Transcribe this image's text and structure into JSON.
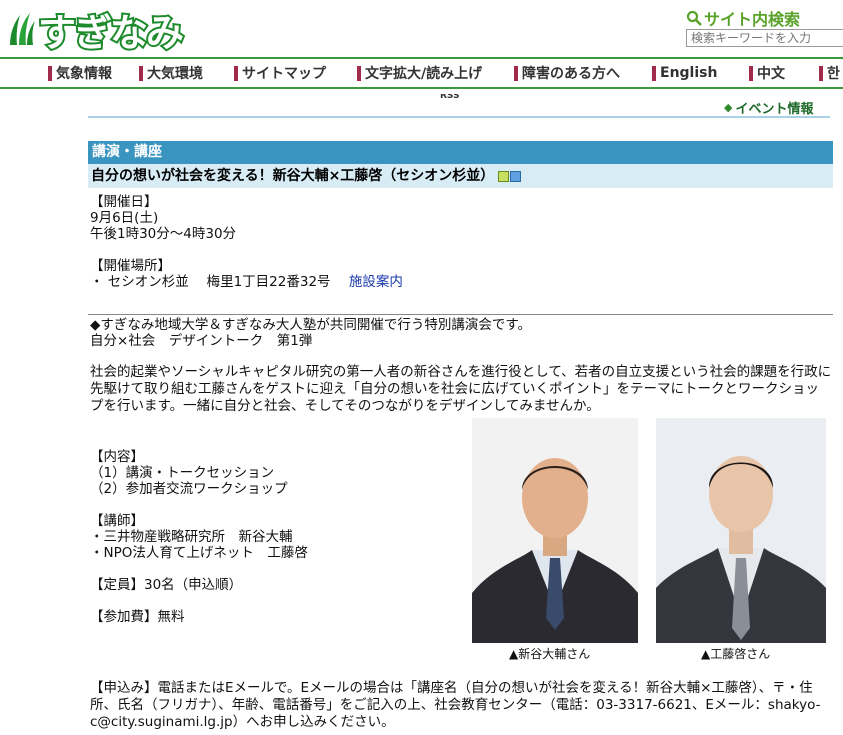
{
  "header": {
    "logo_text": "すぎなみ",
    "search_title": "サイト内検索",
    "search_placeholder": "検索キーワードを入力"
  },
  "nav": [
    {
      "label": "気象情報"
    },
    {
      "label": "大気環境"
    },
    {
      "label": "サイトマップ"
    },
    {
      "label": "文字拡大/読み上げ"
    },
    {
      "label": "障害のある方へ"
    },
    {
      "label": "English"
    },
    {
      "label": "中文"
    },
    {
      "label": "한"
    }
  ],
  "rss_stub": "RSS",
  "event_info": "イベント情報",
  "category": "講演・講座",
  "event_title": "自分の想いが社会を変える！新谷大輔×工藤啓（セシオン杉並）",
  "date": {
    "heading": "【開催日】",
    "day": "9月6日(土)",
    "time": "午後1時30分～4時30分"
  },
  "venue": {
    "heading": "【開催場所】",
    "place": "・ セシオン杉並　 梅里1丁目22番32号",
    "facility_link": "施設案内"
  },
  "description": {
    "line1": "◆すぎなみ地域大学＆すぎなみ大人塾が共同開催で行う特別講演会です。",
    "line2": "自分×社会　デザイントーク　第1弾",
    "paragraph": "社会的起業やソーシャルキャピタル研究の第一人者の新谷さんを進行役として、若者の自立支援という社会的課題を行政に先駆けて取り組む工藤さんをゲストに迎え「自分の想いを社会に広げていくポイント」をテーマにトークとワークショップを行います。一緒に自分と社会、そしてそのつながりをデザインしてみませんか。"
  },
  "content": {
    "heading": "【内容】",
    "item1": "（1）講演・トークセッション",
    "item2": "（2）参加者交流ワークショップ"
  },
  "lecturers": {
    "heading": "【講師】",
    "item1": "・三井物産戦略研究所　新谷大輔",
    "item2": "・NPO法人育て上げネット　工藤啓"
  },
  "capacity": "【定員】30名（申込順）",
  "fee": "【参加費】無料",
  "photos": [
    {
      "caption": "▲新谷大輔さん"
    },
    {
      "caption": "▲工藤啓さん"
    }
  ],
  "application": "【申込み】電話またはEメールで。Eメールの場合は「講座名（自分の想いが社会を変える！新谷大輔×工藤啓）、〒・住所、氏名（フリガナ）、年齢、電話番号」をご記入の上、社会教育センター（電話：03-3317-6621、Eメール：shakyo-c@city.suginami.lg.jp）へお申し込みください。",
  "colors": {
    "brand_green": "#1d8a2c",
    "nav_accent": "#a12b4a",
    "category_blue": "#3a94c0",
    "title_bg": "#d8ecf6"
  }
}
